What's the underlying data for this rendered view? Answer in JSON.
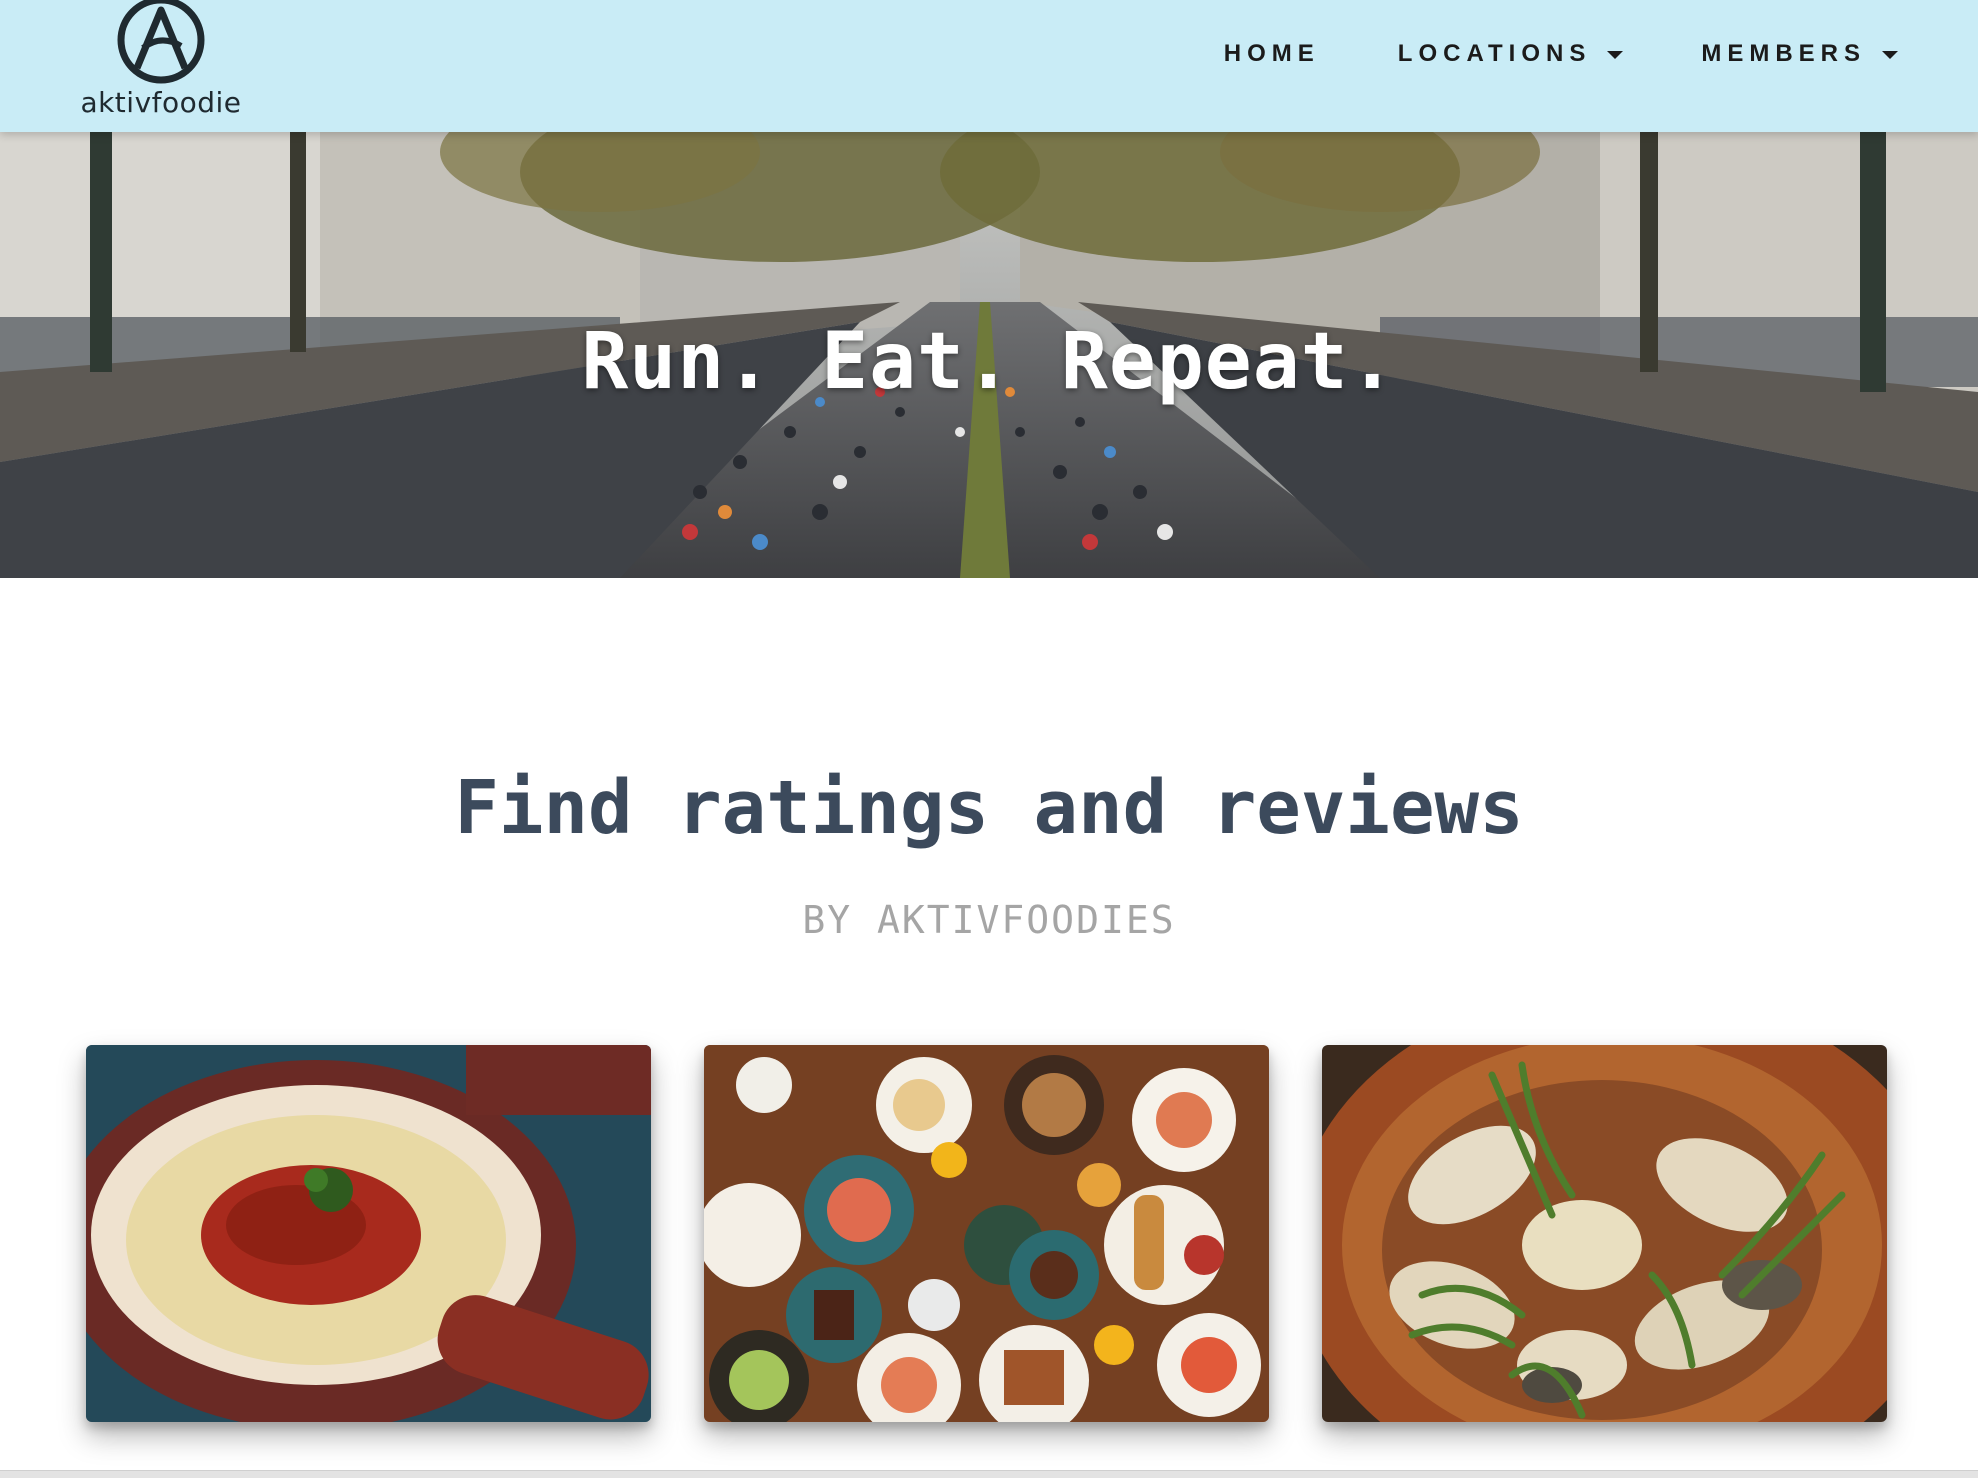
{
  "brand": {
    "name": "aktivfoodie",
    "logo_icon": "circled-a-icon"
  },
  "nav": {
    "items": [
      {
        "label": "HOME",
        "has_dropdown": false
      },
      {
        "label": "LOCATIONS",
        "has_dropdown": true
      },
      {
        "label": "MEMBERS",
        "has_dropdown": true
      }
    ]
  },
  "hero": {
    "title": "Run. Eat. Repeat.",
    "image": "marathon-runners-city-street"
  },
  "section": {
    "title": "Find ratings and reviews",
    "subtitle": "BY AKTIVFOODIES"
  },
  "cards": [
    {
      "image": "tomato-sauce-over-couscous-bowl"
    },
    {
      "image": "brunch-table-spread"
    },
    {
      "image": "dish-in-sauce-with-green-beans"
    }
  ],
  "colors": {
    "navbar_bg": "#c9ecf6",
    "heading": "#3c4a5c",
    "subheading": "#a5a5a5",
    "nav_text": "#1b1b1b"
  }
}
